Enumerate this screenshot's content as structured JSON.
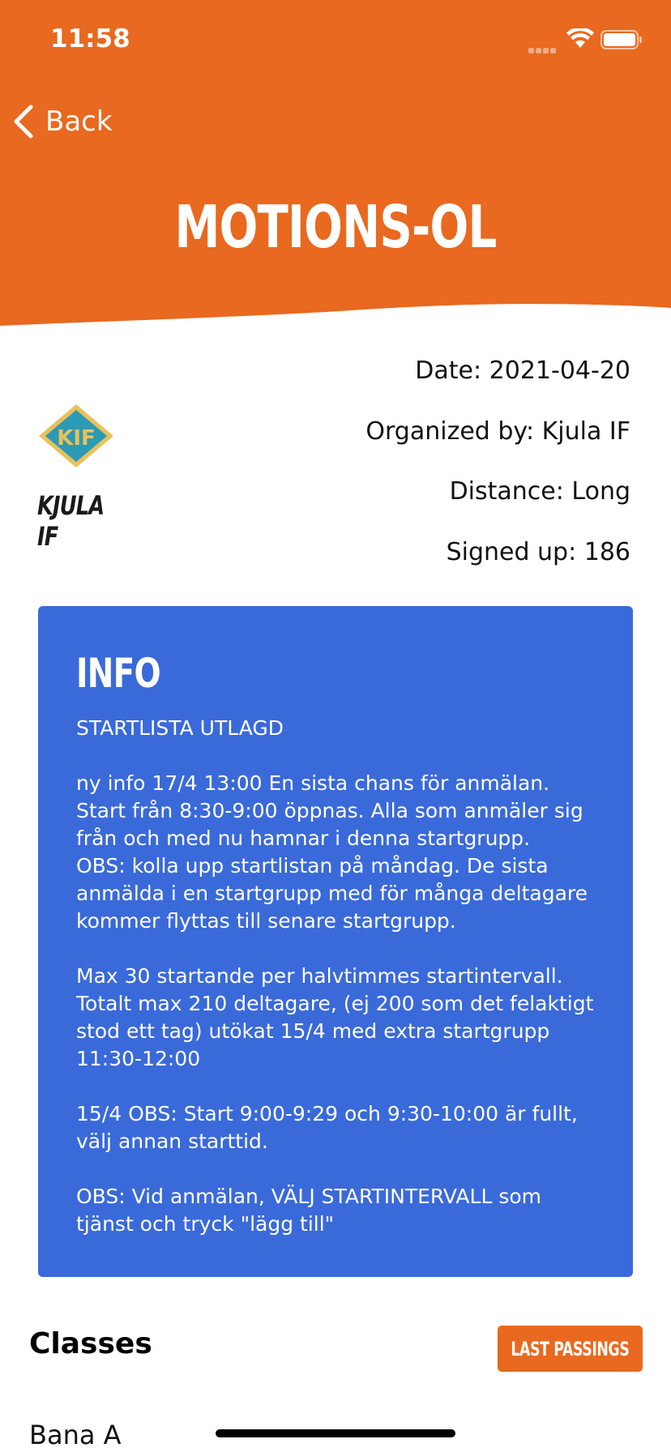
{
  "status_bar": {
    "time": "11:58"
  },
  "nav": {
    "back_label": "Back"
  },
  "event": {
    "title": "MOTIONS-OL",
    "date": "Date: 2021-04-20",
    "organized_by": "Organized by: Kjula IF",
    "distance": "Distance: Long",
    "signed_up": "Signed up: 186"
  },
  "club": {
    "name": "KJULA IF",
    "logo_text": "KIF"
  },
  "info": {
    "title": "INFO",
    "lines": [
      "STARTLISTA UTLAGD",
      "",
      "ny info 17/4  13:00   En sista chans för anmälan.",
      "Start från 8:30-9:00 öppnas. Alla som anmäler sig",
      "från och med nu hamnar i denna startgrupp.",
      "OBS: kolla upp startlistan på måndag. De sista",
      "anmälda i en startgrupp med för många deltagare",
      "kommer flyttas till senare startgrupp.",
      "",
      "Max 30 startande per halvtimmes startintervall.",
      "Totalt max 210 deltagare, (ej 200 som det felaktigt",
      "stod ett tag) utökat 15/4 med extra startgrupp",
      "11:30-12:00",
      "",
      "15/4  OBS:  Start 9:00-9:29 och 9:30-10:00 är fullt,",
      "välj annan starttid.",
      "",
      "OBS:  Vid anmälan,  VÄLJ STARTINTERVALL som",
      "tjänst och tryck \"lägg till\""
    ]
  },
  "classes": {
    "heading": "Classes",
    "last_passings_label": "LAST PASSINGS",
    "items": [
      "Bana A"
    ]
  },
  "colors": {
    "header_orange": "#e8691f",
    "info_blue": "#3a6ad9",
    "button_orange": "#e8691f"
  }
}
